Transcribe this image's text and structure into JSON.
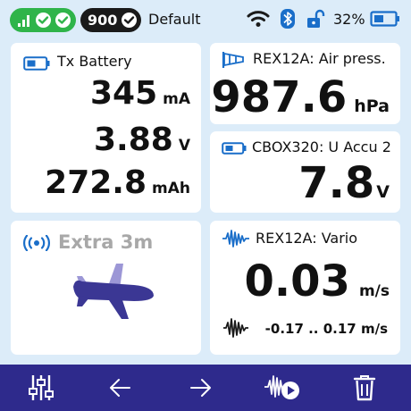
{
  "status": {
    "profile_number": "900",
    "profile_name": "Default",
    "battery_percent": "32%"
  },
  "colors": {
    "accent": "#2e2a8c",
    "link_ok": "#2fb44a",
    "icon_blue": "#1a6ec9",
    "plane": "#3b3794",
    "background": "#dcecf9"
  },
  "tx_battery": {
    "title": "Tx Battery",
    "current": {
      "value": "345",
      "unit": "mA"
    },
    "voltage": {
      "value": "3.88",
      "unit": "V"
    },
    "capacity": {
      "value": "272.8",
      "unit": "mAh"
    }
  },
  "air_pressure": {
    "title": "REX12A: Air press.",
    "value": "987.6",
    "unit": "hPa"
  },
  "cbox": {
    "title": "CBOX320: U Accu 2",
    "value": "7.8",
    "unit": "V"
  },
  "extra": {
    "title": "Extra 3m",
    "icon": "airplane-icon"
  },
  "vario": {
    "title": "REX12A: Vario",
    "value": "0.03",
    "unit": "m/s",
    "range": "-0.17 .. 0.17 m/s"
  },
  "toolbar": {
    "buttons": [
      "sliders-icon",
      "arrow-left-icon",
      "arrow-right-icon",
      "vario-play-icon",
      "trash-icon"
    ]
  }
}
